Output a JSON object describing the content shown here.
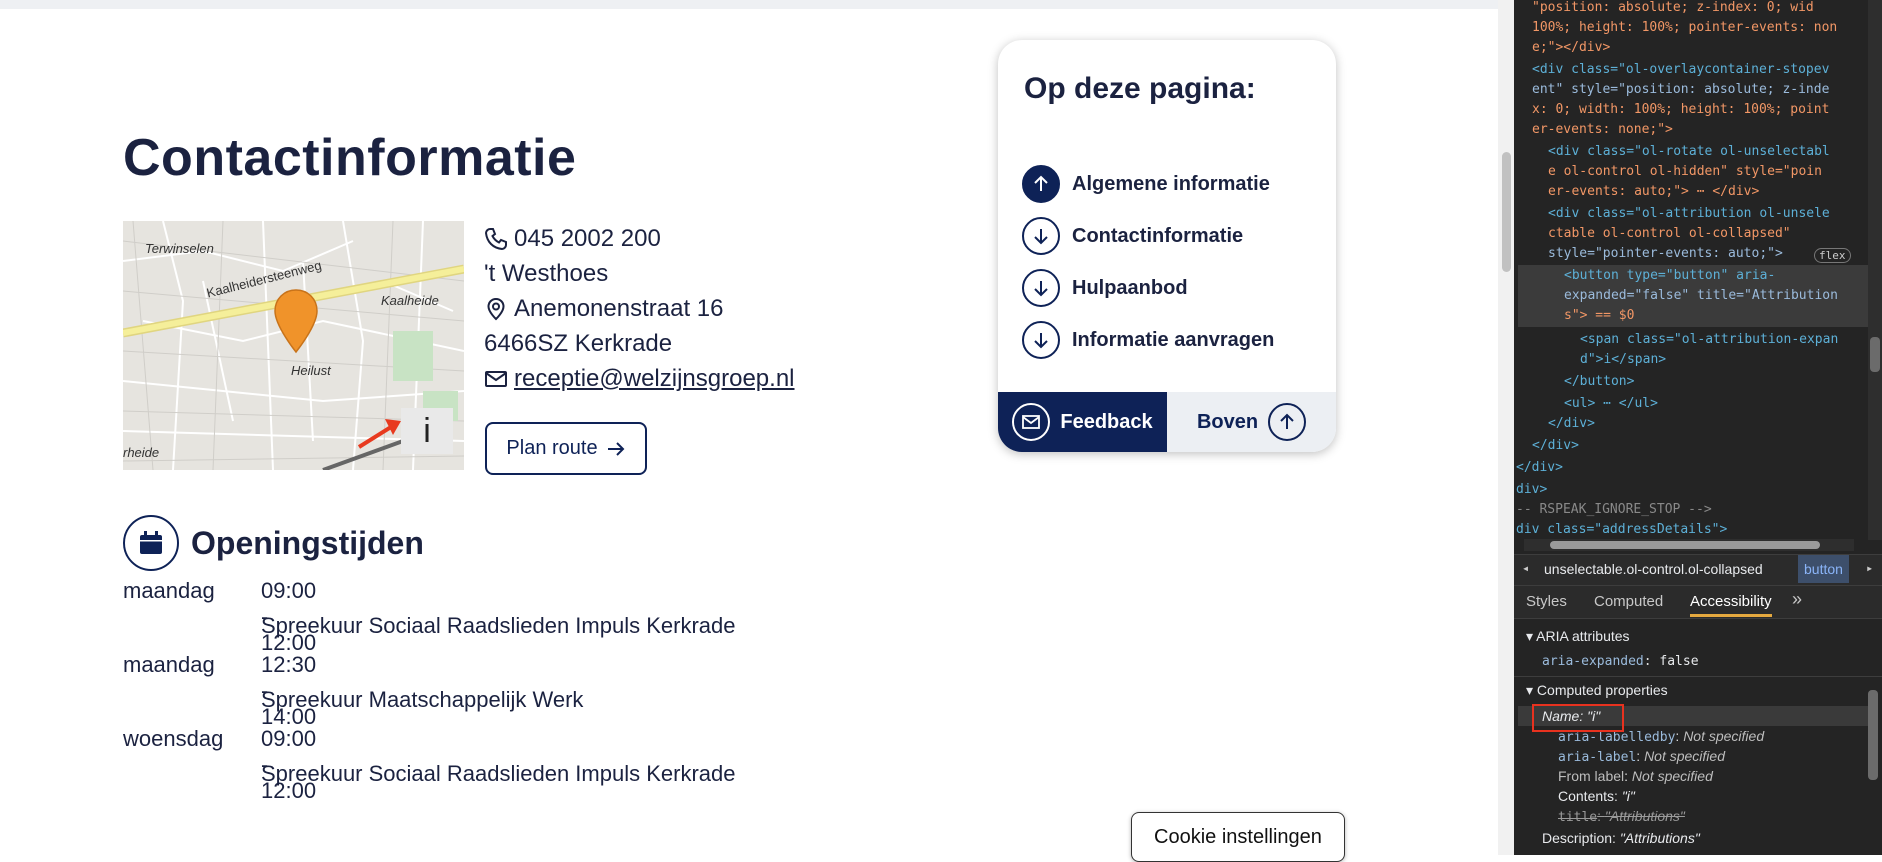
{
  "page": {
    "title": "Contactinformatie",
    "map": {
      "labels": [
        "Terwinselen",
        "Kaalheidersteenweg",
        "Kaalheide",
        "Heilust",
        "rheide"
      ],
      "info_button": "i"
    },
    "contact": {
      "phone": "045 2002 200",
      "location_name": "'t Westhoes",
      "street": "Anemonenstraat 16",
      "postal_city": "6466SZ Kerkrade",
      "email": "receptie@welzijnsgroep.nl",
      "route_button": "Plan route"
    },
    "opening_hours": {
      "heading": "Openingstijden",
      "entries": [
        {
          "day": "maandag",
          "time": "09:00 - 12:00",
          "desc": "Spreekuur Sociaal Raadslieden Impuls Kerkrade"
        },
        {
          "day": "maandag",
          "time": "12:30 - 14:00",
          "desc": "Spreekuur Maatschappelijk Werk"
        },
        {
          "day": "woensdag",
          "time": "09:00 - 12:00",
          "desc": "Spreekuur Sociaal Raadslieden Impuls Kerkrade"
        }
      ]
    },
    "toc": {
      "heading": "Op deze pagina:",
      "items": [
        "Algemene informatie",
        "Contactinformatie",
        "Hulpaanbod",
        "Informatie aanvragen"
      ],
      "feedback": "Feedback",
      "top": "Boven"
    },
    "cookie_button": "Cookie instellingen"
  },
  "devtools": {
    "code": [
      "\"position: absolute; z-index: 0; wid",
      "100%; height: 100%; pointer-events: non",
      "e;\"></div>",
      "<div class=\"ol-overlaycontainer-stopev",
      "ent\" style=\"position: absolute; z-inde",
      "x: 0; width: 100%; height: 100%; point",
      "er-events: none;\">",
      "<div class=\"ol-rotate ol-unselectabl",
      "e ol-control ol-hidden\" style=\"poin",
      "er-events: auto;\"> ⋯ </div>",
      "<div class=\"ol-attribution ol-unsele",
      "ctable ol-control ol-collapsed\"",
      "style=\"pointer-events: auto;\">",
      "<button type=\"button\" aria-",
      "expanded=\"false\" title=\"Attribution",
      "s\"> == $0",
      "<span class=\"ol-attribution-expan",
      "d\">i</span>",
      "</button>",
      "<ul> ⋯ </ul>",
      "</div>",
      "</div>",
      "</div>",
      "div>",
      "-- RSPEAK_IGNORE_STOP -->",
      "div class=\"addressDetails\">"
    ],
    "flex_badge": "flex",
    "breadcrumb": [
      "unselectable.ol-control.ol-collapsed",
      "button"
    ],
    "tabs": [
      "Styles",
      "Computed",
      "Accessibility"
    ],
    "active_tab": "Accessibility",
    "aria_section": "ARIA attributes",
    "aria_expanded": {
      "key": "aria-expanded",
      "value": "false"
    },
    "computed_section": "Computed properties",
    "name_line": "Name: \"i\"",
    "labelledby": {
      "key": "aria-labelledby",
      "value": "Not specified"
    },
    "label": {
      "key": "aria-label",
      "value": "Not specified"
    },
    "from_label": {
      "key": "From label",
      "value": "Not specified"
    },
    "contents": {
      "key": "Contents",
      "value": "\"i\""
    },
    "title_attr": {
      "key": "title",
      "value": "\"Attributions\""
    },
    "description": {
      "key": "Description",
      "value": "\"Attributions\""
    }
  }
}
